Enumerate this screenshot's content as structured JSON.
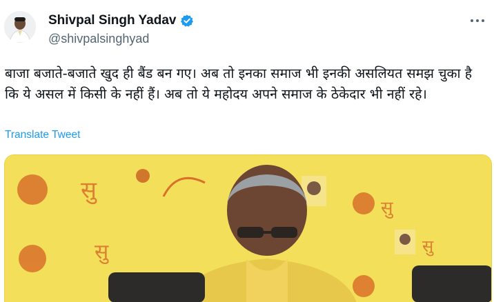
{
  "author": {
    "display_name": "Shivpal Singh Yadav",
    "handle": "@shivpalsinghyad",
    "verified": true,
    "verified_color": "#1d9bf0"
  },
  "more_icon": "more-horizontal-icon",
  "tweet": {
    "text": "बाजा बजाते-बजाते खुद ही बैंड बन गए। अब तो इनका समाज भी इनकी असलियत समझ चुका है कि ये असल में किसी के नहीं हैं। अब तो ये महोदय अपने समाज के ठेकेदार भी नहीं रहे।",
    "translate_label": "Translate Tweet"
  },
  "colors": {
    "link": "#1d9bf0",
    "secondary_text": "#536471",
    "banner_yellow": "#f3df5a"
  }
}
